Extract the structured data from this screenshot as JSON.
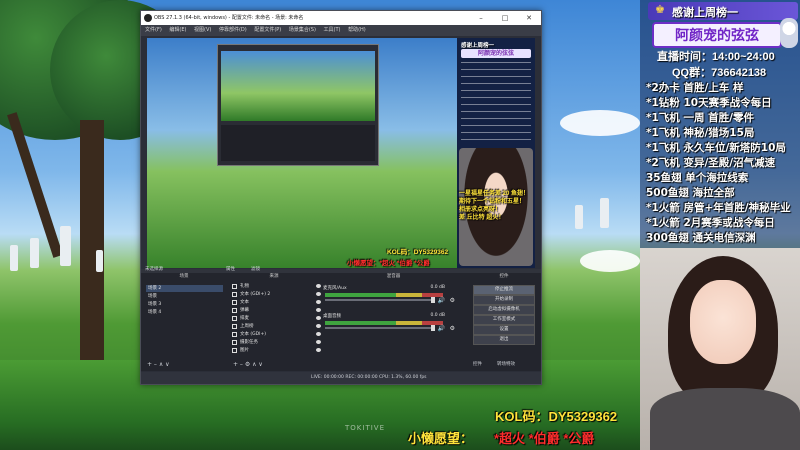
{
  "overlay": {
    "header": "感谢上周榜一",
    "name": "阿颜宠的弦弦",
    "time_label": "直播时间：14:00~24:00",
    "qq_label": "QQ群：736642138",
    "schedule": [
      "*2办卡 首胜/上车 样",
      "*1钻粉 10天赛季战令每日",
      "*1飞机 一周 首胜/零件",
      "*1飞机 神秘/猎场15局",
      "*1飞机 永久车位/新塔防10局",
      "*2飞机 变异/圣殿/沼气减速",
      "35鱼翅 单个海拉线索",
      "500鱼翅 海拉全部",
      "*1火箭 房管+年首胜/神秘毕业",
      "*1火箭 2月赛季或战令每日",
      "300鱼翅 通关电信深渊"
    ],
    "kol": "KOL码：DY5329362",
    "wish_label": "小懒愿望：",
    "wish_items": "*超火 *伯爵 *公爵",
    "watermark": "TOKITIVE"
  },
  "obs": {
    "title": "OBS 27.1.3 (64-bit, windows) - 配置文件: 未命名 - 场景: 未命名",
    "menu": [
      "文件(F)",
      "编辑(E)",
      "视图(V)",
      "停靠部件(D)",
      "配置文件(P)",
      "场景集合(S)",
      "工具(T)",
      "帮助(H)"
    ],
    "preview": {
      "callout_lines": [
        "一星福星任务差 20 鱼翅！",
        "期待下一个钻粉和五星！",
        "相册求点亮呀！",
        "差 丘比特 超火！"
      ],
      "kol": "KOL码：DY5329362",
      "wish": "小懒愿望：*超火 *伯爵 *公爵",
      "mini_header": "感谢上周榜一",
      "mini_name": "阿颜宠的弦弦"
    },
    "source_bar": {
      "label": "未选择源",
      "props": "属性",
      "filters": "滤镜"
    },
    "panes": {
      "scenes": "场景",
      "sources": "来源",
      "mixer": "混音器",
      "transitions": "转场动画",
      "controls": "控件"
    },
    "scene_items": [
      "场景 2",
      "场景",
      "场景 3",
      "场景 4"
    ],
    "source_items": [
      "礼物",
      "文本 (GDI+) 2",
      "文本",
      "弹幕",
      "排麦",
      "上周榜",
      "文本 (GDI+)",
      "摄影任务",
      "图片"
    ],
    "mixer_items": [
      {
        "name": "麦克风/Aux",
        "db": "0.0 dB"
      },
      {
        "name": "桌面音频",
        "db": "0.0 dB"
      }
    ],
    "controls": [
      "停止推流",
      "开始录制",
      "启动虚拟摄像机",
      "工作室模式",
      "设置",
      "退出"
    ],
    "bottom_tabs": [
      "控件",
      "转场特效"
    ],
    "status": "LIVE: 00:00:00   REC: 00:00:00   CPU: 1.3%, 60.00 fps"
  }
}
